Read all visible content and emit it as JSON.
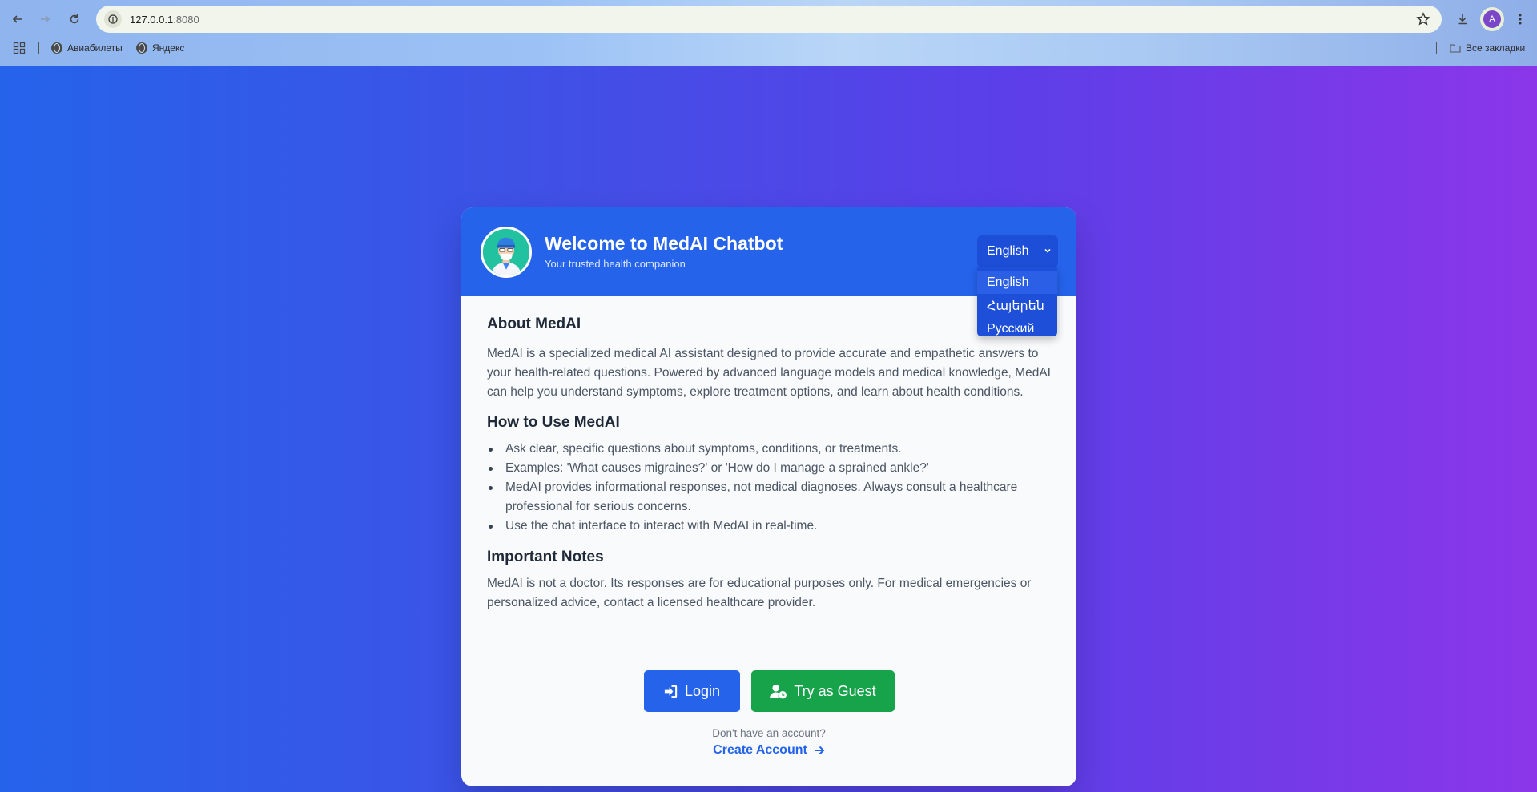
{
  "browser": {
    "url_host": "127.0.0.1",
    "url_port": ":8080",
    "profile_initial": "A",
    "bookmarks": [
      {
        "label": "Авиабилеты"
      },
      {
        "label": "Яндекс"
      }
    ],
    "all_bookmarks_label": "Все закладки"
  },
  "colors": {
    "primary": "#2563eb",
    "success": "#16a34a",
    "gradient_start": "#2563eb",
    "gradient_end": "#8b36e9"
  },
  "header": {
    "title": "Welcome to MedAI Chatbot",
    "subtitle": "Your trusted health companion",
    "logo_icon": "doctor-avatar-icon"
  },
  "language": {
    "selected": "English",
    "options": [
      "English",
      "Հայերեն",
      "Русский"
    ]
  },
  "about": {
    "title": "About MedAI",
    "text": "MedAI is a specialized medical AI assistant designed to provide accurate and empathetic answers to your health-related questions. Powered by advanced language models and medical knowledge, MedAI can help you understand symptoms, explore treatment options, and learn about health conditions."
  },
  "howto": {
    "title": "How to Use MedAI",
    "items": [
      "Ask clear, specific questions about symptoms, conditions, or treatments.",
      "Examples: 'What causes migraines?' or 'How do I manage a sprained ankle?'",
      "MedAI provides informational responses, not medical diagnoses. Always consult a healthcare professional for serious concerns.",
      "Use the chat interface to interact with MedAI in real-time."
    ]
  },
  "notes": {
    "title": "Important Notes",
    "text": "MedAI is not a doctor. Its responses are for educational purposes only. For medical emergencies or personalized advice, contact a licensed healthcare provider."
  },
  "actions": {
    "login_label": "Login",
    "guest_label": "Try as Guest",
    "no_account": "Don't have an account?",
    "create_account": "Create Account"
  }
}
